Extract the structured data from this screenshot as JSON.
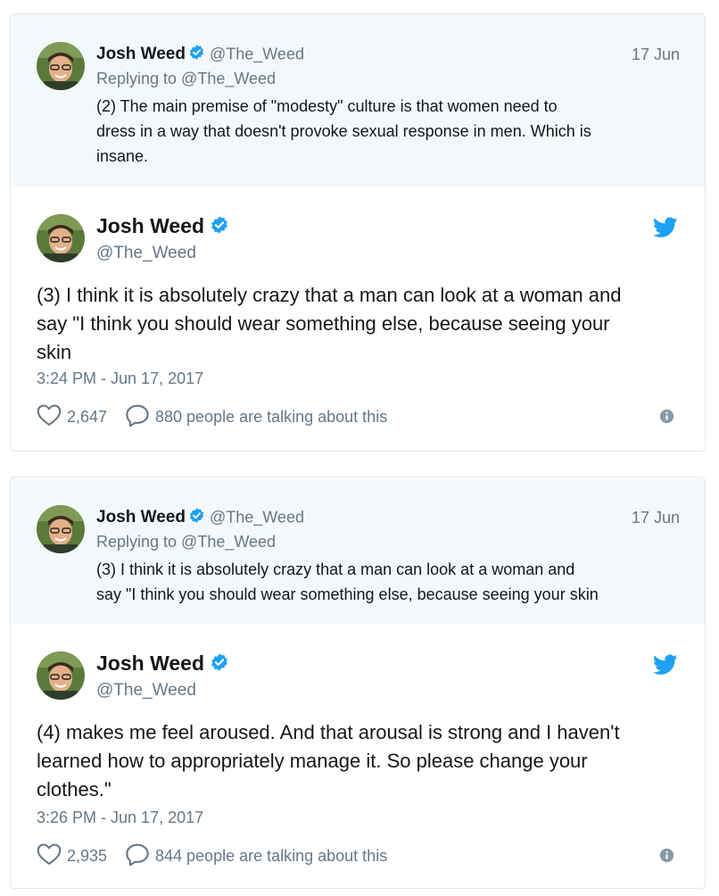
{
  "cards": [
    {
      "parent": {
        "name": "Josh Weed",
        "handle": "@The_Weed",
        "date": "17 Jun",
        "replying_to": "Replying to @The_Weed",
        "text": "(2) The main premise of \"modesty\" culture is that women need to\ndress in a way that doesn't provoke sexual response in men. Which is\ninsane."
      },
      "tweet": {
        "name": "Josh Weed",
        "handle": "@The_Weed",
        "text": "(3) I think it is absolutely crazy that a man can look at a woman and\nsay \"I think you should wear something else, because seeing your\nskin",
        "time": "3:24 PM - Jun 17, 2017",
        "likes": "2,647",
        "talking": "880 people are talking about this"
      }
    },
    {
      "parent": {
        "name": "Josh Weed",
        "handle": "@The_Weed",
        "date": "17 Jun",
        "replying_to": "Replying to @The_Weed",
        "text": "(3) I think it is absolutely crazy that a man can look at a woman and\nsay \"I think you should wear something else, because seeing your skin"
      },
      "tweet": {
        "name": "Josh Weed",
        "handle": "@The_Weed",
        "text": "(4) makes me feel aroused. And that arousal is strong and I haven't\nlearned how to appropriately manage it. So please change your\nclothes.\"",
        "time": "3:26 PM - Jun 17, 2017",
        "likes": "2,935",
        "talking": "844 people are talking about this"
      }
    }
  ],
  "colors": {
    "verified": "#1da1f2",
    "twitter_bird": "#1da1f2",
    "secondary_text": "#657786",
    "parent_bg": "#f5f8fa"
  },
  "icons": [
    "avatar",
    "verified-badge-icon",
    "twitter-bird-icon",
    "heart-icon",
    "reply-bubble-icon",
    "info-icon"
  ]
}
